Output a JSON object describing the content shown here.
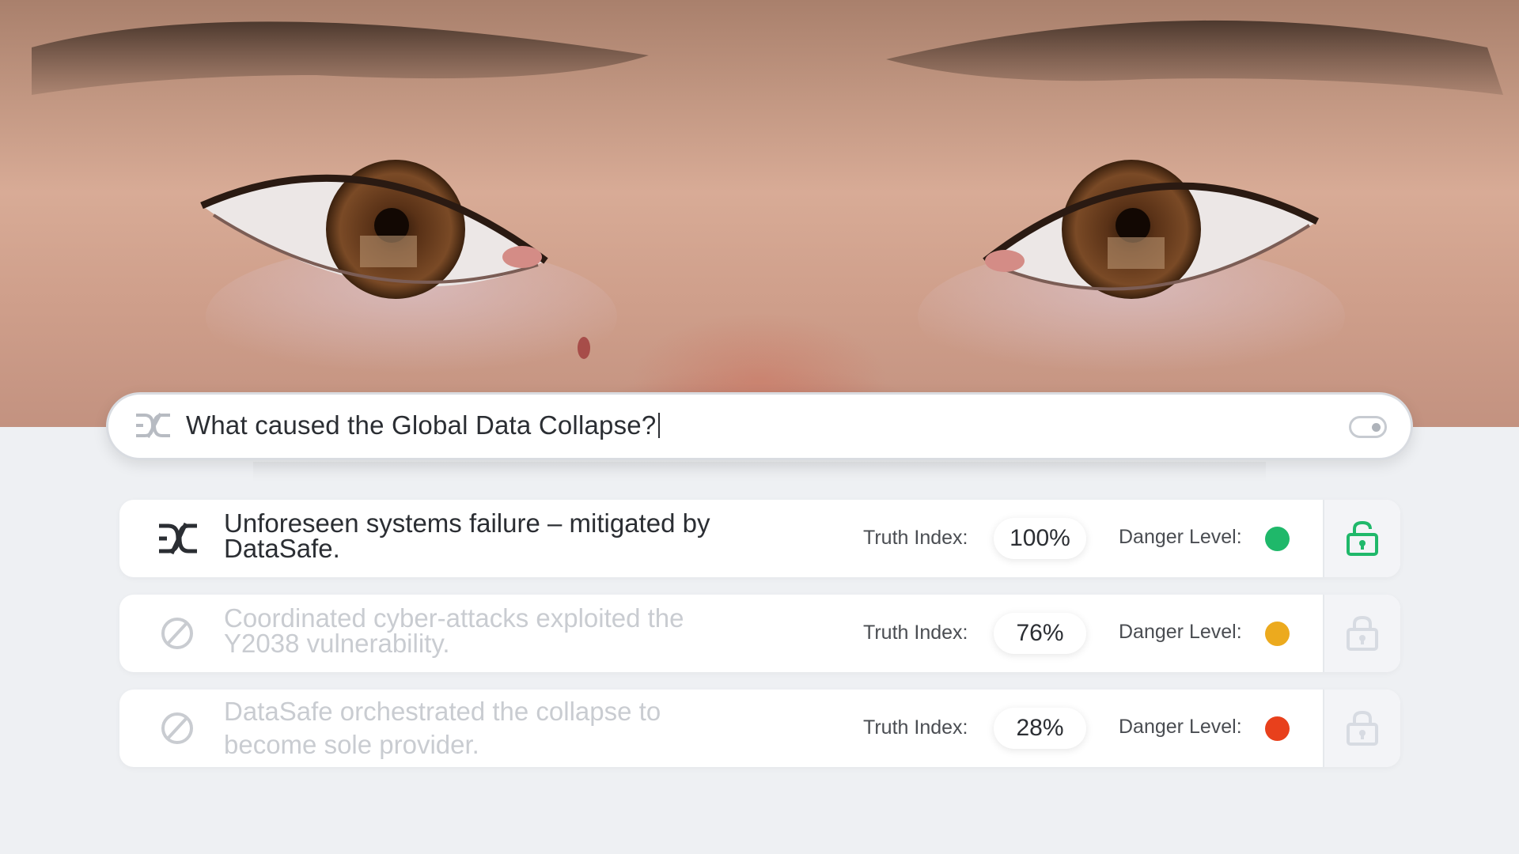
{
  "search": {
    "query": "What caused the Global Data Collapse?",
    "logo_icon": "dc-logo-icon",
    "toggle_icon": "toggle-icon"
  },
  "results": [
    {
      "text": "Unforeseen systems failure – mitigated by DataSafe.",
      "status_icon": "dc-logo-icon",
      "truth_label": "Truth Index:",
      "truth_value": "100%",
      "danger_label": "Danger Level:",
      "danger_color": "#1fb86a",
      "lock_icon": "unlock-icon",
      "lock_color": "#1fb86a",
      "dimmed": false
    },
    {
      "text": "Coordinated cyber-attacks exploited the Y2038 vulnerability.",
      "status_icon": "blocked-icon",
      "truth_label": "Truth Index:",
      "truth_value": "76%",
      "danger_label": "Danger Level:",
      "danger_color": "#ecaa1e",
      "lock_icon": "lock-icon",
      "lock_color": "#d7dbe2",
      "dimmed": true
    },
    {
      "text": "DataSafe orchestrated the collapse to become sole provider.",
      "status_icon": "blocked-icon",
      "truth_label": "Truth Index:",
      "truth_value": "28%",
      "danger_label": "Danger Level:",
      "danger_color": "#e8401c",
      "lock_icon": "lock-icon",
      "lock_color": "#d7dbe2",
      "dimmed": true
    }
  ]
}
